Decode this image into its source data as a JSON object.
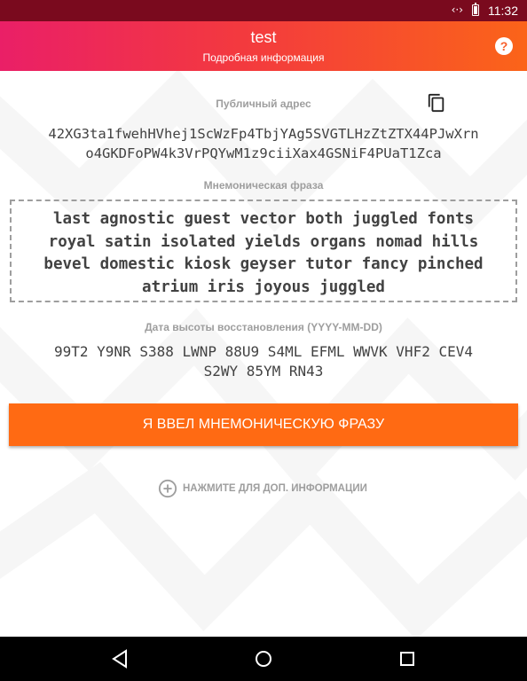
{
  "status_bar": {
    "time": "11:32",
    "wifi_icon": "wifi-arrows-icon",
    "battery_icon": "battery-icon"
  },
  "app_bar": {
    "title": "test",
    "subtitle": "Подробная информация",
    "help_label": "?"
  },
  "public_address": {
    "label": "Публичный адрес",
    "copy_icon": "copy-icon",
    "lines": [
      "42XG3ta1fwehHVhej1ScWzFp4TbjYAg5SVGTLHzZtZTX44PJwXrn",
      "o4GKDFoPW4k3VrPQYwM1z9ciiXax4GSNiF4PUaT1Zca"
    ]
  },
  "mnemonic": {
    "label": "Мнемоническая фраза",
    "lines": [
      "last agnostic guest vector both juggled fonts",
      "royal satin isolated yields organs nomad hills",
      "bevel domestic kiosk geyser tutor fancy pinched",
      "atrium iris joyous juggled"
    ]
  },
  "restore_height": {
    "label": "Дата высоты восстановления (YYYY-MM-DD)",
    "lines": [
      "99T2 Y9NR S388 LWNP 88U9 S4ML EFML WWVK VHF2 CEV4",
      "S2WY 85YM RN43"
    ]
  },
  "confirm_button": {
    "label": "Я ВВЕЛ МНЕМОНИЧЕСКУЮ ФРАЗУ"
  },
  "more_info": {
    "label": "НАЖМИТЕ ДЛЯ ДОП. ИНФОРМАЦИИ",
    "icon": "plus-circle-icon"
  },
  "nav_bar": {
    "back_icon": "back-icon",
    "home_icon": "home-icon",
    "recents_icon": "recents-icon"
  },
  "colors": {
    "status_bar": "#7a0a1e",
    "gradient_start": "#ea1f67",
    "gradient_end": "#fb6419",
    "button": "#ff6a13",
    "label_gray": "#9e9e9e",
    "text_dark": "#424242"
  }
}
